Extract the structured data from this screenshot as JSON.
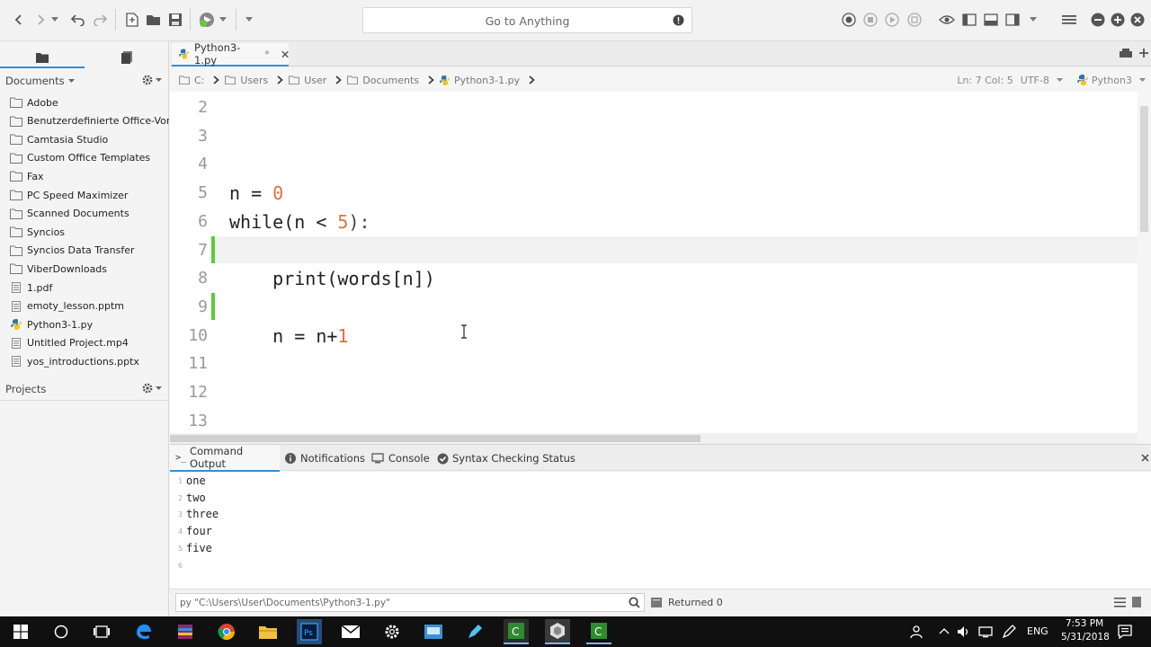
{
  "toolbar": {
    "goto_placeholder": "Go to Anything"
  },
  "left_panel": {
    "section_documents": "Documents",
    "section_projects": "Projects",
    "items": [
      {
        "label": "Adobe",
        "kind": "folder"
      },
      {
        "label": "Benutzerdefinierte Office-Vorl...",
        "kind": "folder"
      },
      {
        "label": "Camtasia Studio",
        "kind": "folder"
      },
      {
        "label": "Custom Office Templates",
        "kind": "folder"
      },
      {
        "label": "Fax",
        "kind": "folder"
      },
      {
        "label": "PC Speed Maximizer",
        "kind": "folder"
      },
      {
        "label": "Scanned Documents",
        "kind": "folder"
      },
      {
        "label": "Syncios",
        "kind": "folder"
      },
      {
        "label": "Syncios Data Transfer",
        "kind": "folder"
      },
      {
        "label": "ViberDownloads",
        "kind": "folder"
      },
      {
        "label": "1.pdf",
        "kind": "file"
      },
      {
        "label": "emoty_lesson.pptm",
        "kind": "file"
      },
      {
        "label": "Python3-1.py",
        "kind": "python"
      },
      {
        "label": "Untitled Project.mp4",
        "kind": "file"
      },
      {
        "label": "yos_introductions.pptx",
        "kind": "file"
      }
    ]
  },
  "editor_tab": {
    "label": "Python3-1.py",
    "modified": "*"
  },
  "breadcrumb": [
    "C:",
    "Users",
    "User",
    "Documents",
    "Python3-1.py"
  ],
  "status_right": {
    "position": "Ln: 7 Col: 5",
    "encoding": "UTF-8",
    "language": "Python3"
  },
  "editor": {
    "line_numbers": [
      "2",
      "3",
      "4",
      "5",
      "6",
      "7",
      "8",
      "9",
      "10",
      "11",
      "12",
      "13"
    ],
    "code": {
      "l5_a": "n = ",
      "l5_num": "0",
      "l6_a": "while(n < ",
      "l6_num": "5",
      "l6_b": "):",
      "l8": "    print(words[n])",
      "l10_a": "    n = n+",
      "l10_num": "1"
    }
  },
  "bottom_tabs": [
    "Command Output",
    "Notifications",
    "Console",
    "Syntax Checking Status"
  ],
  "output": {
    "line_numbers": [
      "1",
      "2",
      "3",
      "4",
      "5",
      "6"
    ],
    "lines": [
      "one",
      "two",
      "three",
      "four",
      "five",
      ""
    ]
  },
  "statusbar": {
    "command": "py \"C:\\Users\\User\\Documents\\Python3-1.py\"",
    "returned": "Returned 0"
  },
  "taskbar": {
    "time": "7:53 PM",
    "date": "5/31/2018",
    "lang": "ENG"
  },
  "colors": {
    "accent": "#2f8fd8",
    "change_marker": "#5ccc37",
    "number": "#e07040"
  }
}
